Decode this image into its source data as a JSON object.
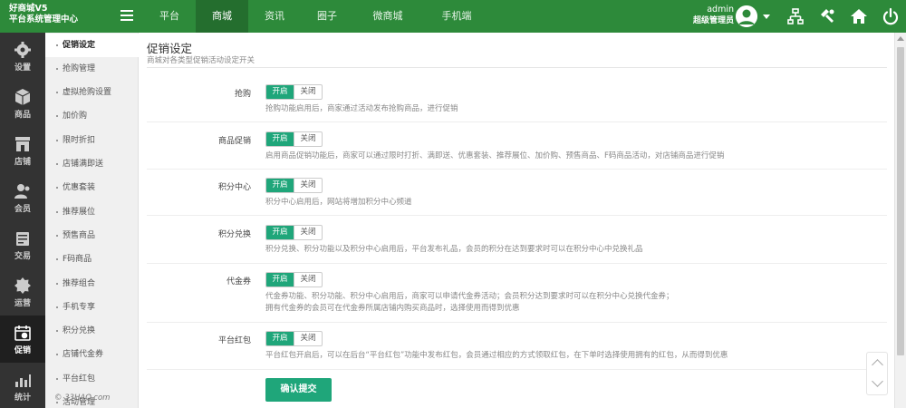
{
  "brand": {
    "line1": "好商城V5",
    "line2": "平台系统管理中心"
  },
  "nav": [
    "平台",
    "商城",
    "资讯",
    "圈子",
    "微商城",
    "手机端"
  ],
  "user": {
    "name": "admin",
    "role": "超级管理员"
  },
  "rail": [
    "设置",
    "商品",
    "店铺",
    "会员",
    "交易",
    "运营",
    "促销",
    "统计"
  ],
  "submenu": [
    "促销设定",
    "抢购管理",
    "虚拟抢购设置",
    "加价购",
    "限时折扣",
    "店铺满即送",
    "优惠套装",
    "推荐展位",
    "预售商品",
    "F码商品",
    "推荐组合",
    "手机专享",
    "积分兑换",
    "店铺代金券",
    "平台红包",
    "活动管理"
  ],
  "page": {
    "title": "促销设定",
    "desc": "商城对各类型促销活动设定开关"
  },
  "toggle": {
    "on": "开启",
    "off": "关闭"
  },
  "settings": [
    {
      "label": "抢购",
      "hint": "抢购功能启用后，商家通过活动发布抢购商品，进行促销"
    },
    {
      "label": "商品促销",
      "hint": "启用商品促销功能后，商家可以通过限时打折、满即送、优惠套装、推荐展位、加价购、预售商品、F码商品活动，对店铺商品进行促销"
    },
    {
      "label": "积分中心",
      "hint": "积分中心启用后，网站将增加积分中心频道"
    },
    {
      "label": "积分兑换",
      "hint": "积分兑换、积分功能以及积分中心启用后，平台发布礼品，会员的积分在达到要求时可以在积分中心中兑换礼品"
    },
    {
      "label": "代金券",
      "hint": "代金券功能、积分功能、积分中心启用后，商家可以申请代金券活动；会员积分达到要求时可以在积分中心兑换代金券；",
      "hint2": "拥有代金券的会员可在代金券所属店铺内购买商品时，选择使用而得到优惠"
    },
    {
      "label": "平台红包",
      "hint": "平台红包开启后，可以在后台“平台红包”功能中发布红包，会员通过相应的方式领取红包，在下单时选择使用拥有的红包，从而得到优惠"
    }
  ],
  "submit_label": "确认提交",
  "watermark": "© 33HAO.com",
  "colors": {
    "header": "#2d8a3a",
    "accent": "#1fa67a",
    "rail": "#333333"
  },
  "icons": [
    "menu-icon",
    "user-avatar-icon",
    "sitemap-icon",
    "tools-icon",
    "home-icon",
    "power-icon",
    "gear-icon",
    "box-icon",
    "store-icon",
    "users-icon",
    "cart-icon",
    "campaign-icon",
    "calendar-icon",
    "chart-icon"
  ]
}
